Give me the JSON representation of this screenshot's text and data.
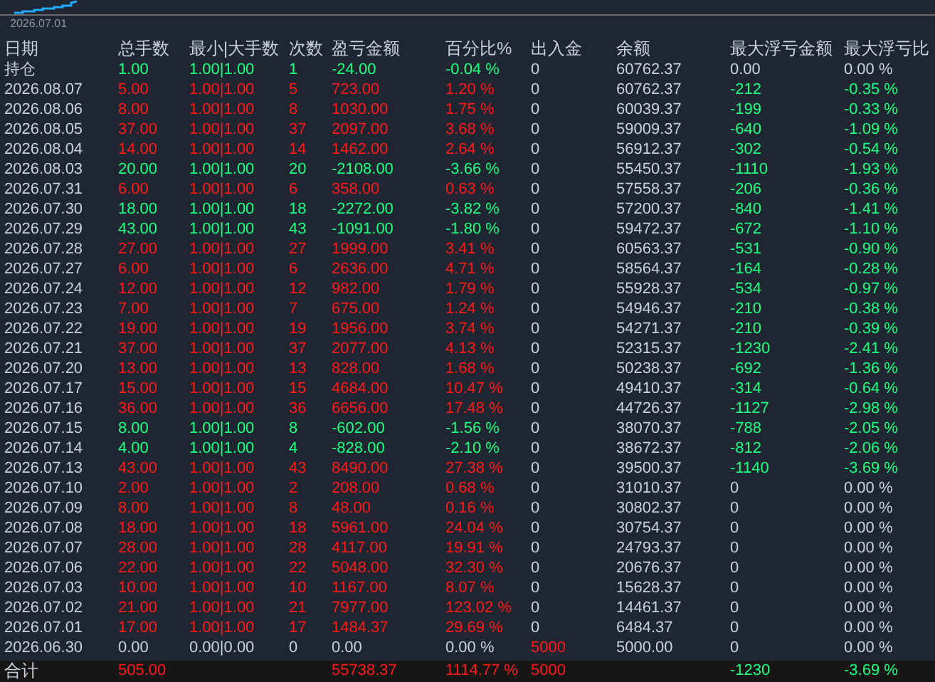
{
  "chart": {
    "date_label": "2026.07.01"
  },
  "columns": [
    "日期",
    "总手数",
    "最小|大手数",
    "次数",
    "盈亏金额",
    "百分比%",
    "出入金",
    "余额",
    "最大浮亏金额",
    "最大浮亏比"
  ],
  "rows": [
    {
      "date": "持仓",
      "trade": {
        "color": "#1aff80",
        "cells": [
          "1.00",
          "1.00|1.00",
          "1",
          "-24.00",
          "-0.04 %"
        ]
      },
      "inout": {
        "text": "0",
        "color": "#c8d0dc"
      },
      "balance": "60762.37",
      "max_float": {
        "color": "#c8d0dc",
        "cells": [
          "0.00",
          "0.00 %"
        ]
      }
    },
    {
      "date": "2026.08.07",
      "trade": {
        "color": "#ff1a1a",
        "cells": [
          "5.00",
          "1.00|1.00",
          "5",
          "723.00",
          "1.20 %"
        ]
      },
      "inout": {
        "text": "0",
        "color": "#c8d0dc"
      },
      "balance": "60762.37",
      "max_float": {
        "color": "#1aff80",
        "cells": [
          "-212",
          "-0.35 %"
        ]
      }
    },
    {
      "date": "2026.08.06",
      "trade": {
        "color": "#ff1a1a",
        "cells": [
          "8.00",
          "1.00|1.00",
          "8",
          "1030.00",
          "1.75 %"
        ]
      },
      "inout": {
        "text": "0",
        "color": "#c8d0dc"
      },
      "balance": "60039.37",
      "max_float": {
        "color": "#1aff80",
        "cells": [
          "-199",
          "-0.33 %"
        ]
      }
    },
    {
      "date": "2026.08.05",
      "trade": {
        "color": "#ff1a1a",
        "cells": [
          "37.00",
          "1.00|1.00",
          "37",
          "2097.00",
          "3.68 %"
        ]
      },
      "inout": {
        "text": "0",
        "color": "#c8d0dc"
      },
      "balance": "59009.37",
      "max_float": {
        "color": "#1aff80",
        "cells": [
          "-640",
          "-1.09 %"
        ]
      }
    },
    {
      "date": "2026.08.04",
      "trade": {
        "color": "#ff1a1a",
        "cells": [
          "14.00",
          "1.00|1.00",
          "14",
          "1462.00",
          "2.64 %"
        ]
      },
      "inout": {
        "text": "0",
        "color": "#c8d0dc"
      },
      "balance": "56912.37",
      "max_float": {
        "color": "#1aff80",
        "cells": [
          "-302",
          "-0.54 %"
        ]
      }
    },
    {
      "date": "2026.08.03",
      "trade": {
        "color": "#1aff80",
        "cells": [
          "20.00",
          "1.00|1.00",
          "20",
          "-2108.00",
          "-3.66 %"
        ]
      },
      "inout": {
        "text": "0",
        "color": "#c8d0dc"
      },
      "balance": "55450.37",
      "max_float": {
        "color": "#1aff80",
        "cells": [
          "-1110",
          "-1.93 %"
        ]
      }
    },
    {
      "date": "2026.07.31",
      "trade": {
        "color": "#ff1a1a",
        "cells": [
          "6.00",
          "1.00|1.00",
          "6",
          "358.00",
          "0.63 %"
        ]
      },
      "inout": {
        "text": "0",
        "color": "#c8d0dc"
      },
      "balance": "57558.37",
      "max_float": {
        "color": "#1aff80",
        "cells": [
          "-206",
          "-0.36 %"
        ]
      }
    },
    {
      "date": "2026.07.30",
      "trade": {
        "color": "#1aff80",
        "cells": [
          "18.00",
          "1.00|1.00",
          "18",
          "-2272.00",
          "-3.82 %"
        ]
      },
      "inout": {
        "text": "0",
        "color": "#c8d0dc"
      },
      "balance": "57200.37",
      "max_float": {
        "color": "#1aff80",
        "cells": [
          "-840",
          "-1.41 %"
        ]
      }
    },
    {
      "date": "2026.07.29",
      "trade": {
        "color": "#1aff80",
        "cells": [
          "43.00",
          "1.00|1.00",
          "43",
          "-1091.00",
          "-1.80 %"
        ]
      },
      "inout": {
        "text": "0",
        "color": "#c8d0dc"
      },
      "balance": "59472.37",
      "max_float": {
        "color": "#1aff80",
        "cells": [
          "-672",
          "-1.10 %"
        ]
      }
    },
    {
      "date": "2026.07.28",
      "trade": {
        "color": "#ff1a1a",
        "cells": [
          "27.00",
          "1.00|1.00",
          "27",
          "1999.00",
          "3.41 %"
        ]
      },
      "inout": {
        "text": "0",
        "color": "#c8d0dc"
      },
      "balance": "60563.37",
      "max_float": {
        "color": "#1aff80",
        "cells": [
          "-531",
          "-0.90 %"
        ]
      }
    },
    {
      "date": "2026.07.27",
      "trade": {
        "color": "#ff1a1a",
        "cells": [
          "6.00",
          "1.00|1.00",
          "6",
          "2636.00",
          "4.71 %"
        ]
      },
      "inout": {
        "text": "0",
        "color": "#c8d0dc"
      },
      "balance": "58564.37",
      "max_float": {
        "color": "#1aff80",
        "cells": [
          "-164",
          "-0.28 %"
        ]
      }
    },
    {
      "date": "2026.07.24",
      "trade": {
        "color": "#ff1a1a",
        "cells": [
          "12.00",
          "1.00|1.00",
          "12",
          "982.00",
          "1.79 %"
        ]
      },
      "inout": {
        "text": "0",
        "color": "#c8d0dc"
      },
      "balance": "55928.37",
      "max_float": {
        "color": "#1aff80",
        "cells": [
          "-534",
          "-0.97 %"
        ]
      }
    },
    {
      "date": "2026.07.23",
      "trade": {
        "color": "#ff1a1a",
        "cells": [
          "7.00",
          "1.00|1.00",
          "7",
          "675.00",
          "1.24 %"
        ]
      },
      "inout": {
        "text": "0",
        "color": "#c8d0dc"
      },
      "balance": "54946.37",
      "max_float": {
        "color": "#1aff80",
        "cells": [
          "-210",
          "-0.38 %"
        ]
      }
    },
    {
      "date": "2026.07.22",
      "trade": {
        "color": "#ff1a1a",
        "cells": [
          "19.00",
          "1.00|1.00",
          "19",
          "1956.00",
          "3.74 %"
        ]
      },
      "inout": {
        "text": "0",
        "color": "#c8d0dc"
      },
      "balance": "54271.37",
      "max_float": {
        "color": "#1aff80",
        "cells": [
          "-210",
          "-0.39 %"
        ]
      }
    },
    {
      "date": "2026.07.21",
      "trade": {
        "color": "#ff1a1a",
        "cells": [
          "37.00",
          "1.00|1.00",
          "37",
          "2077.00",
          "4.13 %"
        ]
      },
      "inout": {
        "text": "0",
        "color": "#c8d0dc"
      },
      "balance": "52315.37",
      "max_float": {
        "color": "#1aff80",
        "cells": [
          "-1230",
          "-2.41 %"
        ]
      }
    },
    {
      "date": "2026.07.20",
      "trade": {
        "color": "#ff1a1a",
        "cells": [
          "13.00",
          "1.00|1.00",
          "13",
          "828.00",
          "1.68 %"
        ]
      },
      "inout": {
        "text": "0",
        "color": "#c8d0dc"
      },
      "balance": "50238.37",
      "max_float": {
        "color": "#1aff80",
        "cells": [
          "-692",
          "-1.36 %"
        ]
      }
    },
    {
      "date": "2026.07.17",
      "trade": {
        "color": "#ff1a1a",
        "cells": [
          "15.00",
          "1.00|1.00",
          "15",
          "4684.00",
          "10.47 %"
        ]
      },
      "inout": {
        "text": "0",
        "color": "#c8d0dc"
      },
      "balance": "49410.37",
      "max_float": {
        "color": "#1aff80",
        "cells": [
          "-314",
          "-0.64 %"
        ]
      }
    },
    {
      "date": "2026.07.16",
      "trade": {
        "color": "#ff1a1a",
        "cells": [
          "36.00",
          "1.00|1.00",
          "36",
          "6656.00",
          "17.48 %"
        ]
      },
      "inout": {
        "text": "0",
        "color": "#c8d0dc"
      },
      "balance": "44726.37",
      "max_float": {
        "color": "#1aff80",
        "cells": [
          "-1127",
          "-2.98 %"
        ]
      }
    },
    {
      "date": "2026.07.15",
      "trade": {
        "color": "#1aff80",
        "cells": [
          "8.00",
          "1.00|1.00",
          "8",
          "-602.00",
          "-1.56 %"
        ]
      },
      "inout": {
        "text": "0",
        "color": "#c8d0dc"
      },
      "balance": "38070.37",
      "max_float": {
        "color": "#1aff80",
        "cells": [
          "-788",
          "-2.05 %"
        ]
      }
    },
    {
      "date": "2026.07.14",
      "trade": {
        "color": "#1aff80",
        "cells": [
          "4.00",
          "1.00|1.00",
          "4",
          "-828.00",
          "-2.10 %"
        ]
      },
      "inout": {
        "text": "0",
        "color": "#c8d0dc"
      },
      "balance": "38672.37",
      "max_float": {
        "color": "#1aff80",
        "cells": [
          "-812",
          "-2.06 %"
        ]
      }
    },
    {
      "date": "2026.07.13",
      "trade": {
        "color": "#ff1a1a",
        "cells": [
          "43.00",
          "1.00|1.00",
          "43",
          "8490.00",
          "27.38 %"
        ]
      },
      "inout": {
        "text": "0",
        "color": "#c8d0dc"
      },
      "balance": "39500.37",
      "max_float": {
        "color": "#1aff80",
        "cells": [
          "-1140",
          "-3.69 %"
        ]
      }
    },
    {
      "date": "2026.07.10",
      "trade": {
        "color": "#ff1a1a",
        "cells": [
          "2.00",
          "1.00|1.00",
          "2",
          "208.00",
          "0.68 %"
        ]
      },
      "inout": {
        "text": "0",
        "color": "#c8d0dc"
      },
      "balance": "31010.37",
      "max_float": {
        "color": "#c8d0dc",
        "cells": [
          "0",
          "0.00 %"
        ]
      }
    },
    {
      "date": "2026.07.09",
      "trade": {
        "color": "#ff1a1a",
        "cells": [
          "8.00",
          "1.00|1.00",
          "8",
          "48.00",
          "0.16 %"
        ]
      },
      "inout": {
        "text": "0",
        "color": "#c8d0dc"
      },
      "balance": "30802.37",
      "max_float": {
        "color": "#c8d0dc",
        "cells": [
          "0",
          "0.00 %"
        ]
      }
    },
    {
      "date": "2026.07.08",
      "trade": {
        "color": "#ff1a1a",
        "cells": [
          "18.00",
          "1.00|1.00",
          "18",
          "5961.00",
          "24.04 %"
        ]
      },
      "inout": {
        "text": "0",
        "color": "#c8d0dc"
      },
      "balance": "30754.37",
      "max_float": {
        "color": "#c8d0dc",
        "cells": [
          "0",
          "0.00 %"
        ]
      }
    },
    {
      "date": "2026.07.07",
      "trade": {
        "color": "#ff1a1a",
        "cells": [
          "28.00",
          "1.00|1.00",
          "28",
          "4117.00",
          "19.91 %"
        ]
      },
      "inout": {
        "text": "0",
        "color": "#c8d0dc"
      },
      "balance": "24793.37",
      "max_float": {
        "color": "#c8d0dc",
        "cells": [
          "0",
          "0.00 %"
        ]
      }
    },
    {
      "date": "2026.07.06",
      "trade": {
        "color": "#ff1a1a",
        "cells": [
          "22.00",
          "1.00|1.00",
          "22",
          "5048.00",
          "32.30 %"
        ]
      },
      "inout": {
        "text": "0",
        "color": "#c8d0dc"
      },
      "balance": "20676.37",
      "max_float": {
        "color": "#c8d0dc",
        "cells": [
          "0",
          "0.00 %"
        ]
      }
    },
    {
      "date": "2026.07.03",
      "trade": {
        "color": "#ff1a1a",
        "cells": [
          "10.00",
          "1.00|1.00",
          "10",
          "1167.00",
          "8.07 %"
        ]
      },
      "inout": {
        "text": "0",
        "color": "#c8d0dc"
      },
      "balance": "15628.37",
      "max_float": {
        "color": "#c8d0dc",
        "cells": [
          "0",
          "0.00 %"
        ]
      }
    },
    {
      "date": "2026.07.02",
      "trade": {
        "color": "#ff1a1a",
        "cells": [
          "21.00",
          "1.00|1.00",
          "21",
          "7977.00",
          "123.02 %"
        ]
      },
      "inout": {
        "text": "0",
        "color": "#c8d0dc"
      },
      "balance": "14461.37",
      "max_float": {
        "color": "#c8d0dc",
        "cells": [
          "0",
          "0.00 %"
        ]
      }
    },
    {
      "date": "2026.07.01",
      "trade": {
        "color": "#ff1a1a",
        "cells": [
          "17.00",
          "1.00|1.00",
          "17",
          "1484.37",
          "29.69 %"
        ]
      },
      "inout": {
        "text": "0",
        "color": "#c8d0dc"
      },
      "balance": "6484.37",
      "max_float": {
        "color": "#c8d0dc",
        "cells": [
          "0",
          "0.00 %"
        ]
      }
    },
    {
      "date": "2026.06.30",
      "trade": {
        "color": "#c8d0dc",
        "cells": [
          "0.00",
          "0.00|0.00",
          "0",
          "0.00",
          "0.00 %"
        ]
      },
      "inout": {
        "text": "5000",
        "color": "#ff1a1a"
      },
      "balance": "5000.00",
      "max_float": {
        "color": "#c8d0dc",
        "cells": [
          "0",
          "0.00 %"
        ]
      }
    }
  ],
  "total": {
    "label": "合计",
    "lots": "505.00",
    "pnl": "55738.37",
    "pct": "1114.77 %",
    "inout": "5000",
    "max_float": "-1230",
    "max_float_pct": "-3.69 %"
  }
}
